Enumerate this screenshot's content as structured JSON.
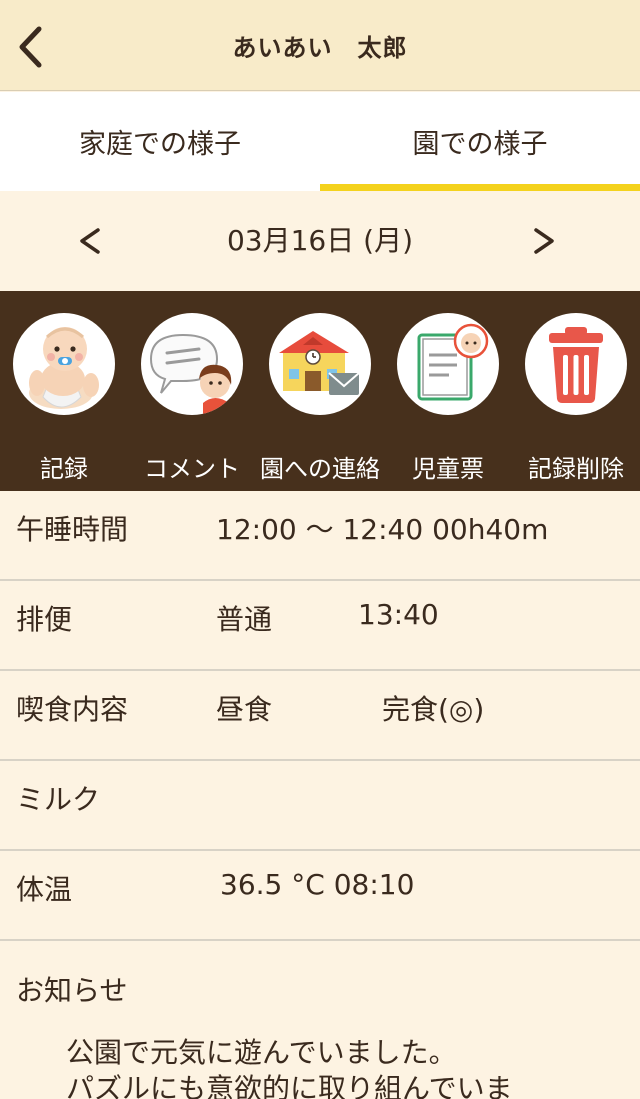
{
  "header": {
    "title": "あいあい　太郎",
    "back_icon": "chevron-left-icon"
  },
  "tabs": [
    {
      "label": "家庭での様子",
      "active": false
    },
    {
      "label": "園での様子",
      "active": true
    }
  ],
  "date_nav": {
    "prev": "<",
    "date": "03月16日 (月)",
    "next": ">"
  },
  "actions": [
    {
      "label": "記録",
      "icon": "baby-icon"
    },
    {
      "label": "コメント",
      "icon": "comment-bubble-icon"
    },
    {
      "label": "園への連絡",
      "icon": "school-mail-icon"
    },
    {
      "label": "児童票",
      "icon": "child-record-icon"
    },
    {
      "label": "記録削除",
      "icon": "trash-icon"
    }
  ],
  "records": {
    "nap": {
      "label": "午睡時間",
      "value": "12:00 ～ 12:40  00h40m"
    },
    "bowel": {
      "label": "排便",
      "value1": "普通",
      "value2": "13:40"
    },
    "meal": {
      "label": "喫食内容",
      "value1": "昼食",
      "value2": "完食(◎)"
    },
    "milk": {
      "label": "ミルク"
    },
    "temp": {
      "label": "体温",
      "value": "36.5 °C  08:10"
    },
    "notice": {
      "label": "お知らせ",
      "line1": "公園で元気に遊んでいました。",
      "line2": "パズルにも意欲的に取り組んでいま"
    }
  },
  "colors": {
    "header_bg": "#f8ebc9",
    "tab_indicator": "#f4d21d",
    "action_bar_bg": "#47301c",
    "page_bg": "#fdf3e2",
    "text": "#3a2a1e"
  }
}
